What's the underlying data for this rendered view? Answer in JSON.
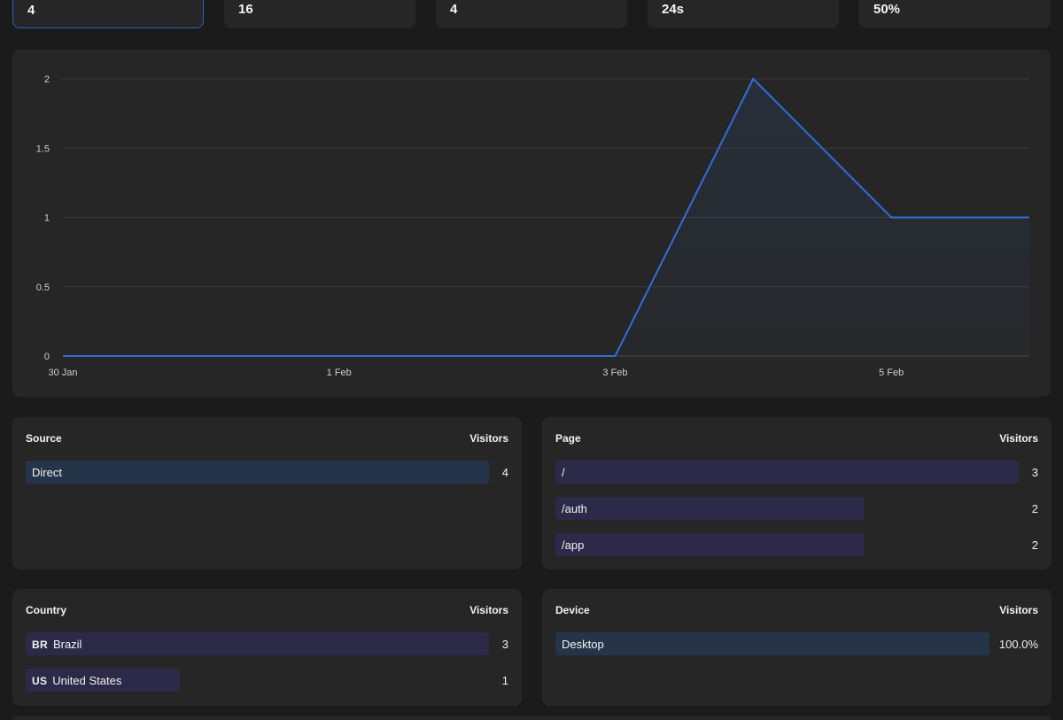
{
  "stats": [
    {
      "value": "4"
    },
    {
      "value": "16"
    },
    {
      "value": "4"
    },
    {
      "value": "24s"
    },
    {
      "value": "50%"
    }
  ],
  "chart_data": {
    "type": "area",
    "x": [
      "30 Jan",
      "31 Jan",
      "1 Feb",
      "2 Feb",
      "3 Feb",
      "4 Feb",
      "5 Feb",
      "6 Feb"
    ],
    "values": [
      0,
      0,
      0,
      0,
      0,
      2,
      1,
      1
    ],
    "xticks": [
      "30 Jan",
      "1 Feb",
      "3 Feb",
      "5 Feb"
    ],
    "yticks": [
      "0",
      "0.5",
      "1",
      "1.5",
      "2"
    ],
    "ylim": [
      0,
      2
    ],
    "grid": true,
    "line_color": "#2f6fd6"
  },
  "sources": {
    "title": "Source",
    "col": "Visitors",
    "rows": [
      {
        "label": "Direct",
        "count": "4",
        "frac": 1.0
      }
    ]
  },
  "pages": {
    "title": "Page",
    "col": "Visitors",
    "rows": [
      {
        "label": "/",
        "count": "3",
        "frac": 1.0
      },
      {
        "label": "/auth",
        "count": "2",
        "frac": 0.6667
      },
      {
        "label": "/app",
        "count": "2",
        "frac": 0.6667
      }
    ]
  },
  "countries": {
    "title": "Country",
    "col": "Visitors",
    "rows": [
      {
        "code": "BR",
        "label": "Brazil",
        "count": "3",
        "frac": 1.0
      },
      {
        "code": "US",
        "label": "United States",
        "count": "1",
        "frac": 0.3333
      }
    ]
  },
  "devices": {
    "title": "Device",
    "col": "Visitors",
    "rows": [
      {
        "label": "Desktop",
        "count": "100.0%",
        "frac": 1.0
      }
    ]
  }
}
